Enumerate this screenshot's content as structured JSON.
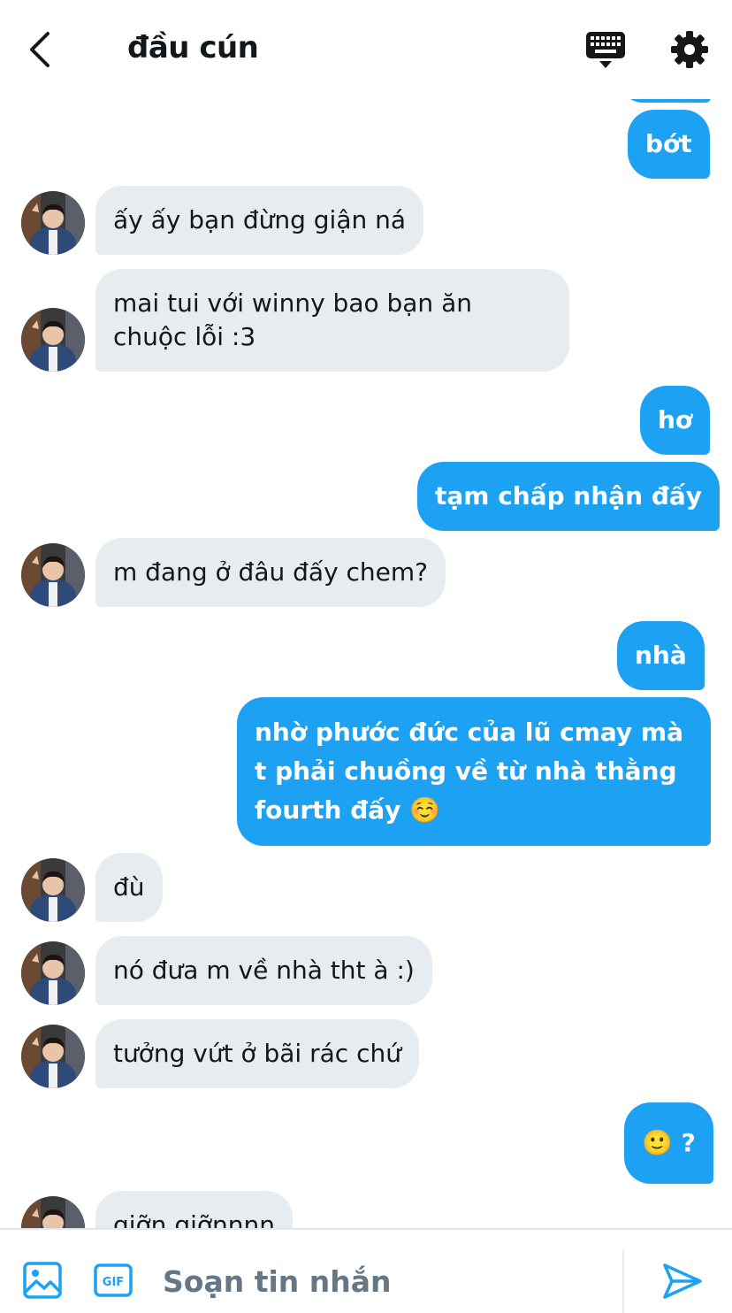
{
  "header": {
    "title": "đầu cún"
  },
  "messages": [
    {
      "from": "me",
      "text": "bớt"
    },
    {
      "from": "them",
      "text": "ấy ấy bạn đừng giận ná"
    },
    {
      "from": "them",
      "text": "mai tui với winny bao bạn ăn chuộc lỗi :3"
    },
    {
      "from": "me",
      "text": "hơ"
    },
    {
      "from": "me",
      "text": "tạm chấp nhận đấy"
    },
    {
      "from": "them",
      "text": "m đang ở đâu đấy chem?"
    },
    {
      "from": "me",
      "text": "nhà"
    },
    {
      "from": "me",
      "text": "nhờ phước đức của lũ cmay mà t phải chuồng về từ nhà thằng fourth đấy ☺️"
    },
    {
      "from": "them",
      "text": "đù"
    },
    {
      "from": "them",
      "text": "nó đưa m về nhà tht à :)"
    },
    {
      "from": "them",
      "text": "tưởng vứt ở bãi rác chứ"
    },
    {
      "from": "me",
      "text": "🙂 ?"
    },
    {
      "from": "them",
      "text": "giỡn giỡnnnn"
    }
  ],
  "composer": {
    "placeholder": "Soạn tin nhắn",
    "gif_label": "GIF"
  },
  "colors": {
    "accent": "#1da1f2",
    "incoming_bubble": "#e6ecf0",
    "text": "#14171a",
    "muted": "#657786"
  },
  "icons": [
    "back-arrow-icon",
    "keyboard-icon",
    "gear-icon",
    "image-icon",
    "gif-icon",
    "send-icon"
  ]
}
